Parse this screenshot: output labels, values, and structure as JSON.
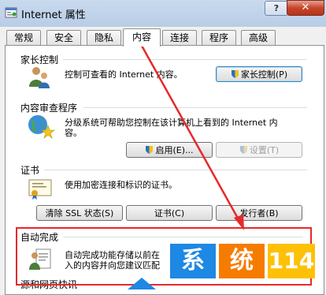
{
  "window": {
    "title": "Internet 属性",
    "help_label": "?",
    "close_label": "✕"
  },
  "tabs": [
    "常规",
    "安全",
    "隐私",
    "内容",
    "连接",
    "程序",
    "高级"
  ],
  "active_tab": "内容",
  "parental": {
    "heading": "家长控制",
    "description": "控制可查看的 Internet 内容。",
    "button": "家长控制(P)"
  },
  "advisor": {
    "heading": "内容审查程序",
    "description_line1": "分级系统可帮助您控制在该计算机上看到的 Internet 内",
    "description_line2": "容。",
    "enable_button": "启用(E)...",
    "settings_button": "设置(T)"
  },
  "certs": {
    "heading": "证书",
    "description": "使用加密连接和标识的证书。",
    "clear_ssl_button": "清除 SSL 状态(S)",
    "certs_button": "证书(C)",
    "publishers_button": "发行者(B)"
  },
  "autocomplete": {
    "heading": "自动完成",
    "description_line1": "自动完成功能存储以前在",
    "description_line2": "入的内容并向您建议匹配"
  },
  "feeds": {
    "heading": "源和网页快讯"
  },
  "watermark": {
    "tile1": "系",
    "tile2": "统",
    "tile3": "114"
  },
  "colors": {
    "highlight_box": "#e8282a",
    "arrow": "#e8282a",
    "watermark_blue": "#1e88e5",
    "watermark_orange": "#f57c00",
    "watermark_yellow": "#ffc107"
  }
}
